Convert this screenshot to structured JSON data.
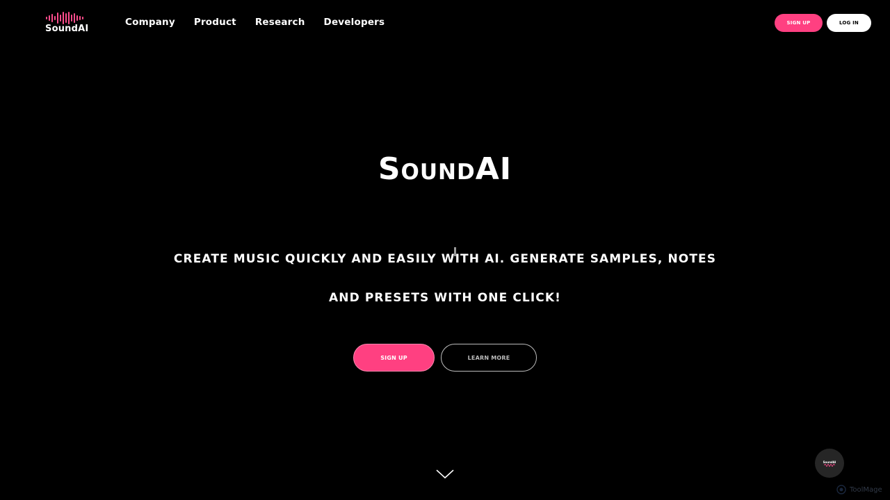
{
  "header": {
    "logo_text": "SoundAI",
    "nav": [
      {
        "label": "Company"
      },
      {
        "label": "Product"
      },
      {
        "label": "Research"
      },
      {
        "label": "Developers"
      }
    ],
    "signup_label": "SIGN UP",
    "login_label": "LOG IN"
  },
  "hero": {
    "title": "SoundAI",
    "subtitle": "CREATE MUSIC QUICKLY AND EASILY WITH AI. GENERATE SAMPLES, NOTES AND PRESETS WITH ONE CLICK!",
    "signup_label": "SIGN UP",
    "learn_more_label": "LEARN MORE"
  },
  "chat_widget": {
    "label": "SoundAI"
  },
  "watermark": {
    "text": "ToolMage"
  },
  "colors": {
    "accent": "#ff4081",
    "background": "#000000",
    "text": "#ffffff"
  },
  "icons": {
    "logo": "sound-wave-icon",
    "scroll": "chevron-down-icon",
    "chat": "chat-bubble-icon"
  }
}
